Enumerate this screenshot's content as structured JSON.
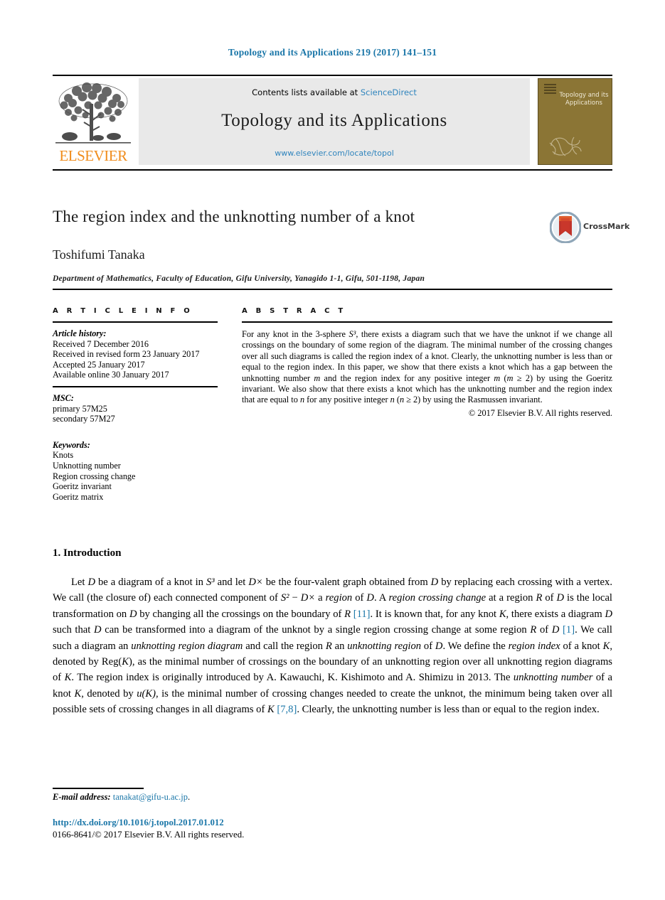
{
  "running_head": "Topology and its Applications 219 (2017) 141–151",
  "masthead": {
    "publisher_wordmark": "ELSEVIER",
    "contents_prefix": "Contents lists available at ",
    "contents_link": "ScienceDirect",
    "journal_name": "Topology and its Applications",
    "journal_url": "www.elsevier.com/locate/topol",
    "cover_title": "Topology and its Applications"
  },
  "article": {
    "title": "The region index and the unknotting number of a knot",
    "crossmark_label": "CrossMark",
    "author": "Toshifumi Tanaka",
    "affiliation": "Department of Mathematics, Faculty of Education, Gifu University, Yanagido 1-1, Gifu, 501-1198, Japan"
  },
  "info": {
    "heading": "A R T I C L E   I N F O",
    "history_label": "Article history:",
    "history": [
      "Received 7 December 2016",
      "Received in revised form 23 January 2017",
      "Accepted 25 January 2017",
      "Available online 30 January 2017"
    ],
    "msc_label": "MSC:",
    "msc": [
      "primary 57M25",
      "secondary 57M27"
    ],
    "keywords_label": "Keywords:",
    "keywords": [
      "Knots",
      "Unknotting number",
      "Region crossing change",
      "Goeritz invariant",
      "Goeritz matrix"
    ]
  },
  "abstract": {
    "heading": "A B S T R A C T",
    "text_part_1": "For any knot in the 3-sphere ",
    "math_s3": "S³",
    "text_part_2": ", there exists a diagram such that we have the unknot if we change all crossings on the boundary of some region of the diagram. The minimal number of the crossing changes over all such diagrams is called the region index of a knot. Clearly, the unknotting number is less than or equal to the region index. In this paper, we show that there exists a knot which has a gap between the unknotting number ",
    "math_m1": "m",
    "text_part_3": " and the region index for any positive integer ",
    "math_m2": "m",
    "text_part_4": " (",
    "math_m3": "m",
    "text_part_5": " ≥ 2) by using the Goeritz invariant. We also show that there exists a knot which has the unknotting number and the region index that are equal to ",
    "math_n1": "n",
    "text_part_6": " for any positive integer ",
    "math_n2": "n",
    "text_part_7": " (",
    "math_n3": "n",
    "text_part_8": " ≥ 2) by using the Rasmussen invariant.",
    "copyright": "© 2017 Elsevier B.V. All rights reserved."
  },
  "section": {
    "number_title": "1. Introduction",
    "paragraph": {
      "p1": "Let ",
      "m_D1": "D",
      "p2": " be a diagram of a knot in ",
      "m_S3": "S³",
      "p3": " and let ",
      "m_Dx": "D×",
      "p4": " be the four-valent graph obtained from ",
      "m_D2": "D",
      "p5": " by replacing each crossing with a vertex. We call (the closure of) each connected component of ",
      "m_S2": "S²",
      "p6": " − ",
      "m_Dx2": "D×",
      "p7": " a ",
      "i_region": "region",
      "p8": " of ",
      "m_D3": "D",
      "p9": ". A ",
      "i_rcc": "region crossing change",
      "p10": " at a region ",
      "m_R1": "R",
      "p11": " of ",
      "m_D4": "D",
      "p12": " is the local transformation on ",
      "m_D5": "D",
      "p13": " by changing all the crossings on the boundary of ",
      "m_R2": "R",
      "p14": " ",
      "cite_11": "[11]",
      "p15": ". It is known that, for any knot ",
      "m_K1": "K",
      "p16": ", there exists a diagram ",
      "m_D6": "D",
      "p17": " such that ",
      "m_D7": "D",
      "p18": " can be transformed into a diagram of the unknot by a single region crossing change at some region ",
      "m_R3": "R",
      "p19": " of ",
      "m_D8": "D",
      "p20": " ",
      "cite_1": "[1]",
      "p21": ". We call such a diagram an ",
      "i_urd": "unknotting region diagram",
      "p22": " and call the region ",
      "m_R4": "R",
      "p23": " an ",
      "i_ur": "unknotting region",
      "p24": " of ",
      "m_D9": "D",
      "p25": ". We define the ",
      "i_ri": "region index",
      "p26": " of a knot ",
      "m_K2": "K",
      "p27": ", denoted by Reg(",
      "m_K3": "K",
      "p28": "), as the minimal number of crossings on the boundary of an unknotting region over all unknotting region diagrams of ",
      "m_K4": "K",
      "p29": ". The region index is originally introduced by A. Kawauchi, K. Kishimoto and A. Shimizu in 2013. The ",
      "i_un": "unknotting number",
      "p30": " of a knot ",
      "m_K5": "K",
      "p31": ", denoted by ",
      "m_uK": "u(K)",
      "p32": ", is the minimal number of crossing changes needed to create the unknot, the minimum being taken over all possible sets of crossing changes in all diagrams of ",
      "m_K6": "K",
      "p33": " ",
      "cite_78": "[7,8]",
      "p34": ". Clearly, the unknotting number is less than or equal to the region index."
    }
  },
  "footer": {
    "email_label": "E-mail address:",
    "email_address": "tanakat@gifu-u.ac.jp",
    "email_period": ".",
    "doi": "http://dx.doi.org/10.1016/j.topol.2017.01.012",
    "issn_copyright": "0166-8641/© 2017 Elsevier B.V. All rights reserved."
  },
  "colors": {
    "link": "#1a76a8",
    "sciencedirect": "#2f84bd",
    "elsevier_orange": "#f08c1b",
    "cover_olive": "#8b7535",
    "masthead_gray": "#e9e9e9"
  }
}
